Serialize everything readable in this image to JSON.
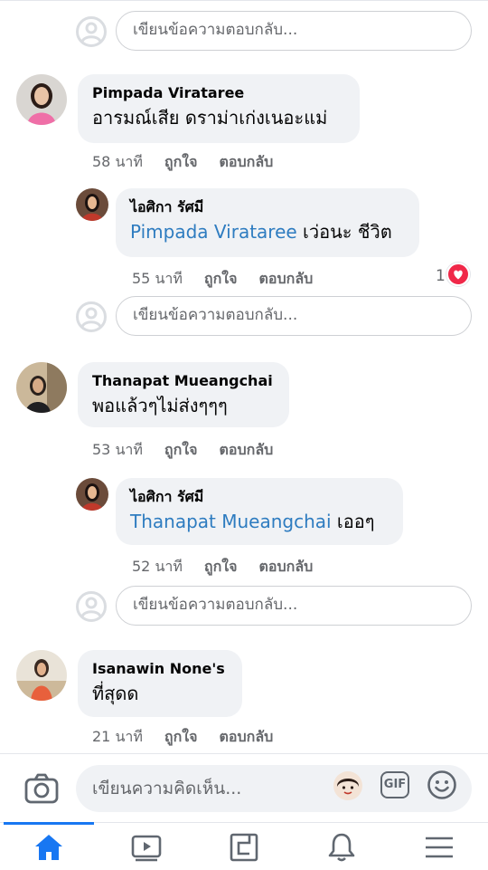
{
  "reply_placeholder": "เขียนข้อความตอบกลับ...",
  "comments": [
    {
      "name": "Pimpada Virataree",
      "text": "อารมณ์เสีย ดราม่าเก่งเนอะแม่",
      "time": "58 นาที",
      "like": "ถูกใจ",
      "reply": "ตอบกลับ"
    },
    {
      "name": "ไอศิกา รัศมี",
      "mention": "Pimpada Virataree",
      "text": " เว่อนะ ชีวิต",
      "time": "55 นาที",
      "like": "ถูกใจ",
      "reply": "ตอบกลับ",
      "reaction_count": "1"
    },
    {
      "name": "Thanapat Mueangchai",
      "text": "พอแล้วๆไม่ส่งๆๆๆ",
      "time": "53 นาที",
      "like": "ถูกใจ",
      "reply": "ตอบกลับ"
    },
    {
      "name": "ไอศิกา รัศมี",
      "mention": "Thanapat Mueangchai",
      "text": " เออๆ",
      "time": "52 นาที",
      "like": "ถูกใจ",
      "reply": "ตอบกลับ"
    },
    {
      "name": "Isanawin None's",
      "text": "ที่สุดด",
      "time": "21 นาที",
      "like": "ถูกใจ",
      "reply": "ตอบกลับ"
    }
  ],
  "composer": {
    "placeholder": "เขียนความคิดเห็น...",
    "gif_label": "GIF"
  },
  "tabs": [
    "home-icon",
    "video-icon",
    "feeds-icon",
    "bell-icon",
    "menu-icon"
  ],
  "colors": {
    "accent": "#1877f2",
    "mention": "#2e7cc0",
    "bubble": "#f0f2f5",
    "heart": "#f02849"
  }
}
